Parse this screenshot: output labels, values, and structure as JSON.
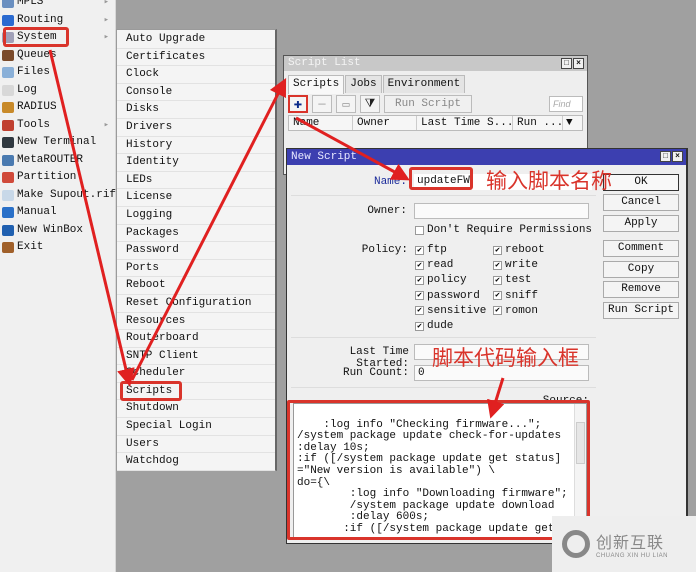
{
  "main_menu": {
    "items": [
      {
        "label": "MPLS",
        "icon": "mpls-icon",
        "has_submenu": true,
        "color": "#6a8fc0"
      },
      {
        "label": "Routing",
        "icon": "routing-icon",
        "has_submenu": true,
        "color": "#2a6ad0"
      },
      {
        "label": "System",
        "icon": "system-gear-icon",
        "has_submenu": true,
        "color": "#a0a0b8"
      },
      {
        "label": "Queues",
        "icon": "queues-icon",
        "has_submenu": false,
        "color": "#7a4a2a"
      },
      {
        "label": "Files",
        "icon": "folder-icon",
        "has_submenu": false,
        "color": "#8ab0d8"
      },
      {
        "label": "Log",
        "icon": "log-icon",
        "has_submenu": false,
        "color": "#d8d8d8"
      },
      {
        "label": "RADIUS",
        "icon": "radius-icon",
        "has_submenu": false,
        "color": "#c88a2a"
      },
      {
        "label": "Tools",
        "icon": "tools-icon",
        "has_submenu": true,
        "color": "#c04030"
      },
      {
        "label": "New Terminal",
        "icon": "terminal-icon",
        "has_submenu": false,
        "color": "#303840"
      },
      {
        "label": "MetaROUTER",
        "icon": "metarouter-icon",
        "has_submenu": false,
        "color": "#4a7ab0"
      },
      {
        "label": "Partition",
        "icon": "partition-icon",
        "has_submenu": false,
        "color": "#d04a3a"
      },
      {
        "label": "Make Supout.rif",
        "icon": "document-icon",
        "has_submenu": false,
        "color": "#c8d8e8"
      },
      {
        "label": "Manual",
        "icon": "help-icon",
        "has_submenu": false,
        "color": "#2a70c8"
      },
      {
        "label": "New WinBox",
        "icon": "winbox-icon",
        "has_submenu": false,
        "color": "#2060b0"
      },
      {
        "label": "Exit",
        "icon": "exit-door-icon",
        "has_submenu": false,
        "color": "#a0602a"
      }
    ],
    "submenu_arrow": "▸"
  },
  "system_submenu": {
    "items": [
      "Auto Upgrade",
      "Certificates",
      "Clock",
      "Console",
      "Disks",
      "Drivers",
      "History",
      "Identity",
      "LEDs",
      "License",
      "Logging",
      "Packages",
      "Password",
      "Ports",
      "Reboot",
      "Reset Configuration",
      "Resources",
      "Routerboard",
      "SNTP Client",
      "Scheduler",
      "Scripts",
      "Shutdown",
      "Special Login",
      "Users",
      "Watchdog"
    ],
    "highlighted": "Scripts"
  },
  "script_list": {
    "title": "Script List",
    "tabs": [
      "Scripts",
      "Jobs",
      "Environment"
    ],
    "active_tab": "Scripts",
    "toolbar": {
      "add": "✚",
      "remove": "—",
      "comment": "▭",
      "filter": "⧩",
      "run_script": "Run Script",
      "find_placeholder": "Find"
    },
    "columns": [
      "Name",
      "Owner",
      "Last Time S...",
      "Run ..."
    ],
    "column_menu": "▼"
  },
  "new_script": {
    "title": "New Script",
    "fields": {
      "name_label": "Name:",
      "name_value": "updateFW",
      "owner_label": "Owner:",
      "owner_value": "",
      "dont_require_permissions": "Don't Require Permissions",
      "policy_label": "Policy:",
      "last_time_started_label": "Last Time Started:",
      "last_time_started_value": "",
      "run_count_label": "Run Count:",
      "run_count_value": "0",
      "source_label": "Source:"
    },
    "policies_left": [
      {
        "label": "ftp",
        "checked": true
      },
      {
        "label": "read",
        "checked": true
      },
      {
        "label": "policy",
        "checked": true
      },
      {
        "label": "password",
        "checked": true
      },
      {
        "label": "sensitive",
        "checked": true
      },
      {
        "label": "dude",
        "checked": true
      }
    ],
    "policies_right": [
      {
        "label": "reboot",
        "checked": true
      },
      {
        "label": "write",
        "checked": true
      },
      {
        "label": "test",
        "checked": true
      },
      {
        "label": "sniff",
        "checked": true
      },
      {
        "label": "romon",
        "checked": true
      }
    ],
    "buttons": [
      "OK",
      "Cancel",
      "Apply",
      "Comment",
      "Copy",
      "Remove",
      "Run Script"
    ],
    "source_code": ":log info \"Checking firmware...\";\n/system package update check-for-updates\n:delay 10s;\n:if ([/system package update get status]\n=\"New version is available\") \\\ndo={\\\n        :log info \"Downloading firmware\";\n        /system package update download\n        :delay 600s;\n       :if ([/system package update get"
  },
  "annotations": {
    "name_hint": "输入脚本名称",
    "source_hint": "脚本代码输入框",
    "annotation_color": "#d9342b"
  },
  "watermark": {
    "cn": "创新互联",
    "en": "CHUANG XIN HU LIAN"
  }
}
